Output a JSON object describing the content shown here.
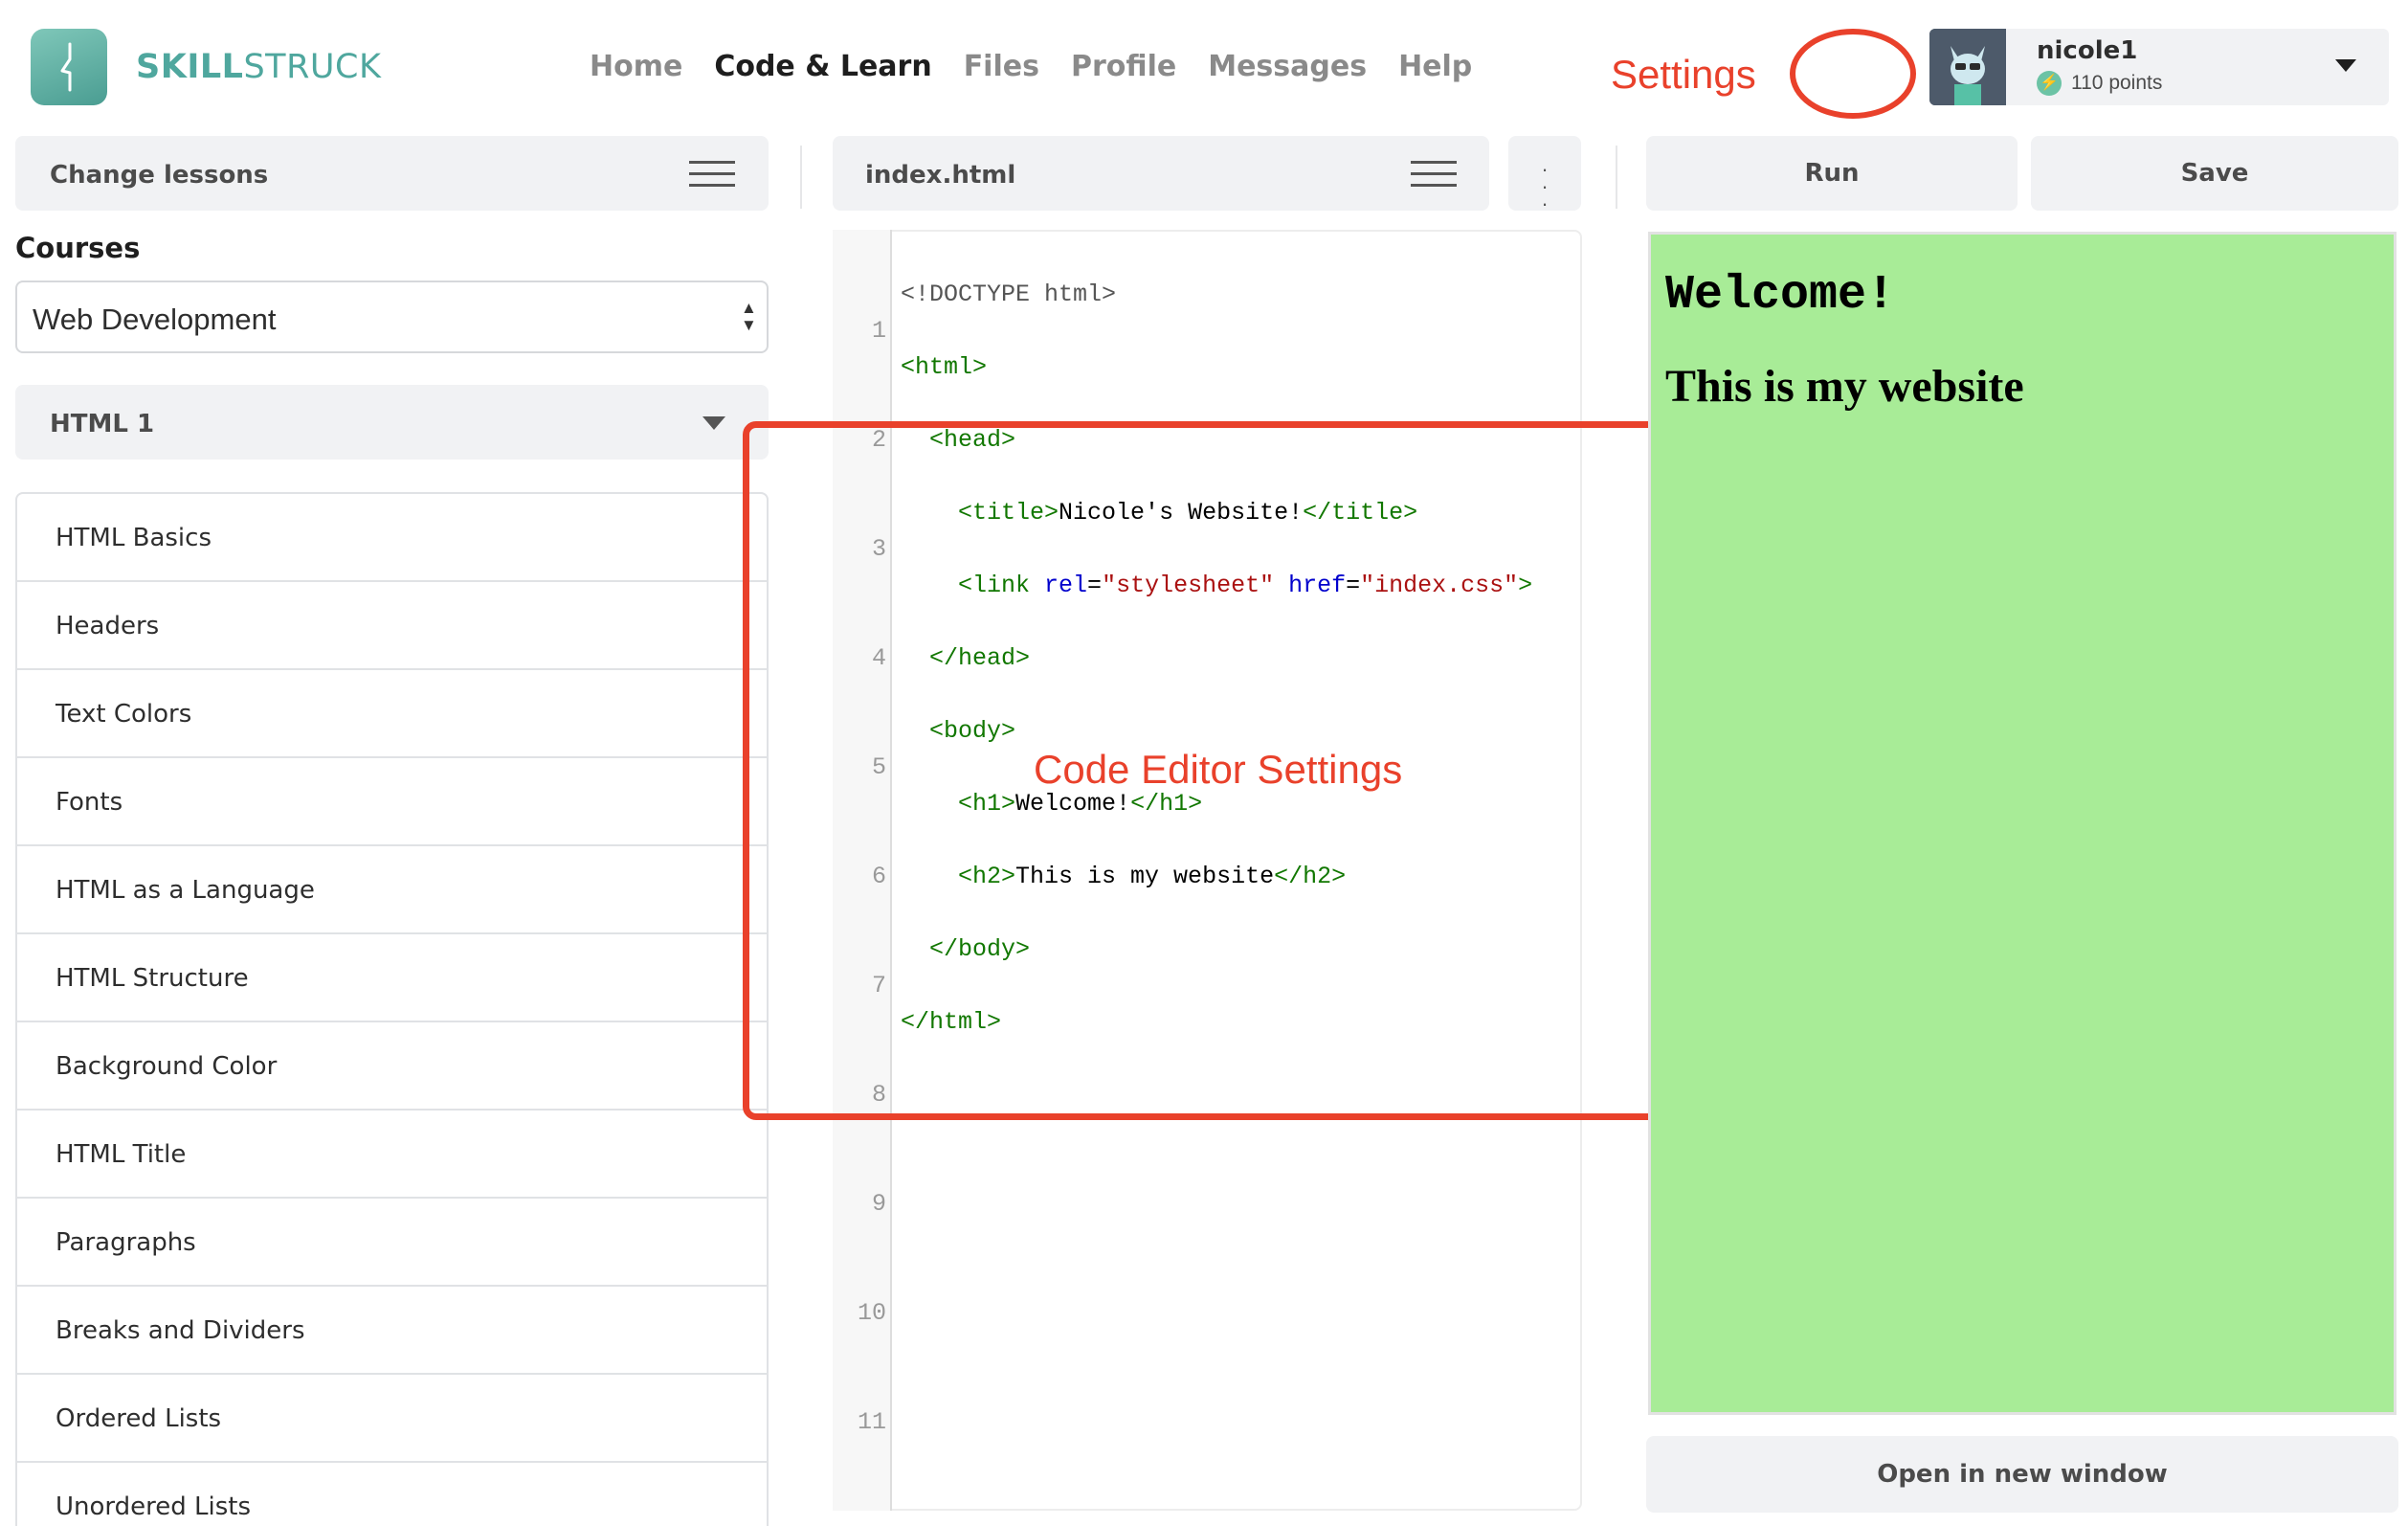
{
  "brand": {
    "bold": "SKILL",
    "light": "STRUCK"
  },
  "nav": [
    "Home",
    "Code & Learn",
    "Files",
    "Profile",
    "Messages",
    "Help"
  ],
  "nav_active": "Code & Learn",
  "annotations": {
    "settings": "Settings",
    "code_editor_settings": "Code Editor Settings",
    "accent_color": "#e9412b"
  },
  "user": {
    "name": "nicole1",
    "points": "110 points"
  },
  "left_panel": {
    "change_lessons": "Change lessons",
    "courses_label": "Courses",
    "course_selected": "Web Development",
    "unit": "HTML 1",
    "lessons": [
      "HTML Basics",
      "Headers",
      "Text Colors",
      "Fonts",
      "HTML as a Language",
      "HTML Structure",
      "Background Color",
      "HTML Title",
      "Paragraphs",
      "Breaks and Dividers",
      "Ordered Lists",
      "Unordered Lists"
    ]
  },
  "editor": {
    "filename": "index.html",
    "line_numbers": [
      "1",
      "2",
      "3",
      "4",
      "5",
      "6",
      "7",
      "8",
      "9",
      "10",
      "11"
    ]
  },
  "toolbar": {
    "run": "Run",
    "save": "Save",
    "open_new_window": "Open in new window"
  },
  "preview": {
    "h1": "Welcome!",
    "h2": "This is my website",
    "background": "#a8ec97"
  }
}
